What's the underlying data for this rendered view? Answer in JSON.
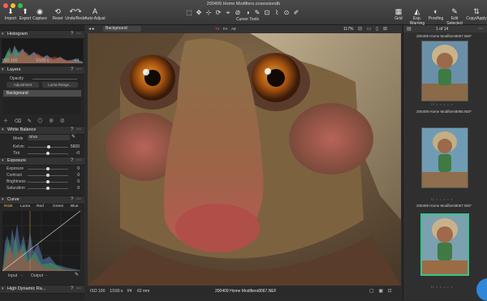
{
  "window": {
    "title": "200409 Home Modifiers.cosessiondb"
  },
  "toolbar_left": [
    {
      "label": "Import",
      "icon": "import-icon",
      "glyph": "⬇"
    },
    {
      "label": "Export",
      "icon": "export-icon",
      "glyph": "⬆"
    },
    {
      "label": "Capture",
      "icon": "camera-icon",
      "glyph": "◉"
    },
    {
      "label": "Reset",
      "icon": "reset-icon",
      "glyph": "⟲"
    },
    {
      "label": "Undo/Redo",
      "icon": "undo-icon",
      "glyph": "↶↷"
    },
    {
      "label": "Auto Adjust",
      "icon": "auto-adjust-icon",
      "glyph": "A"
    }
  ],
  "cursor_tools": {
    "label": "Cursor Tools",
    "glyphs": [
      "⬚",
      "✥",
      "⊹",
      "⟳",
      "⌖",
      "⊘",
      "◑",
      "✎",
      "⊡",
      "⌇",
      "⊙",
      "✐"
    ]
  },
  "toolbar_right": [
    {
      "label": "Grid",
      "icon": "grid-icon",
      "glyph": "▦"
    },
    {
      "label": "Exp. Warning",
      "icon": "exposure-warning-icon",
      "glyph": "◭"
    },
    {
      "label": "Proofing",
      "icon": "proofing-icon",
      "glyph": "◐"
    },
    {
      "label": "Edit Selected",
      "icon": "edit-selected-icon",
      "glyph": "✎"
    },
    {
      "label": "Copy/Apply",
      "icon": "copy-apply-icon",
      "glyph": "⇅"
    }
  ],
  "histogram": {
    "title": "Histogram",
    "iso": "ISO 100",
    "shutter": "1/160 s",
    "aperture": "f/4"
  },
  "layers": {
    "title": "Layers",
    "opacity_label": "Opacity",
    "adjustment": "Adjustment",
    "luma_range": "Luma Range...",
    "background": "Background"
  },
  "white_balance": {
    "title": "White Balance",
    "mode_label": "Mode",
    "mode_value": "Shot",
    "kelvin_label": "Kelvin",
    "kelvin_value": "5600",
    "tint_label": "Tint",
    "tint_value": "-0",
    "kelvin_level": 0.52,
    "tint_level": 0.5
  },
  "exposure": {
    "title": "Exposure",
    "rows": [
      {
        "label": "Exposure",
        "value": "0",
        "level": 0.5
      },
      {
        "label": "Contrast",
        "value": "0",
        "level": 0.5
      },
      {
        "label": "Brightness",
        "value": "0",
        "level": 0.5
      },
      {
        "label": "Saturation",
        "value": "0",
        "level": 0.5
      }
    ]
  },
  "curve": {
    "title": "Curve",
    "tabs": [
      "RGB",
      "Luma",
      "Red",
      "Green",
      "Blue"
    ],
    "input_label": "Input",
    "output_label": "Output",
    "input_value": "-",
    "output_value": "-"
  },
  "hdr": {
    "title": "High Dynamic Ra..."
  },
  "viewer": {
    "variant_name": "Background",
    "zoom": "117%",
    "badges": [
      "T8",
      "FA",
      "A8"
    ]
  },
  "status": {
    "iso": "ISO 100",
    "shutter": "1/160 s",
    "aperture": "f/4",
    "focal": "62 mm",
    "filename": "200409 Home Modifiers8067.NEF"
  },
  "browser": {
    "counter": "1 of 14",
    "thumbs": [
      {
        "name": "200409 Home Modifiers8067.NEF",
        "selected": false
      },
      {
        "name": "200409 Home Modifiers8066.NEF",
        "selected": false
      },
      {
        "name": "200409 Home Modifiers8067.NEF",
        "selected": true
      }
    ]
  },
  "colors": {
    "accent": "#39c38a",
    "selection": "#3d7bd6",
    "panel_bg": "#262626"
  }
}
